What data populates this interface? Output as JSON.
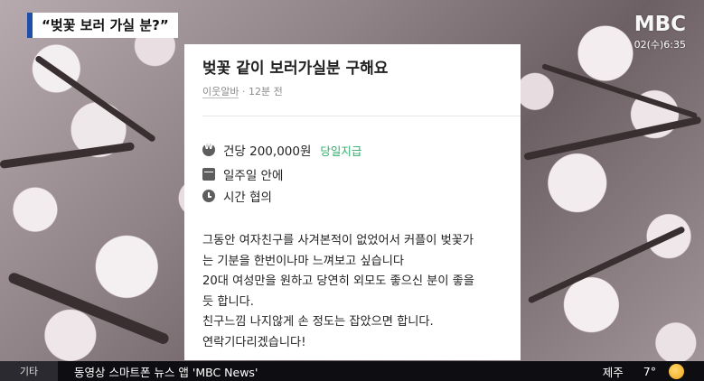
{
  "caption": "“벚꽃 보러 가실 분?”",
  "logo": {
    "name": "MBC",
    "time": "02(수)6:35"
  },
  "post": {
    "title": "벚꽃 같이 보러가실분 구해요",
    "author": "이웃알바",
    "posted": "· 12분 전",
    "pay": "건당 200,000원",
    "pay_badge": "당일지급",
    "duration": "일주일 안에",
    "hours": "시간 협의",
    "body_lines": [
      "그동안 여자친구를 사겨본적이 없었어서 커플이 벚꽃가",
      "는 기분을 한번이나마 느껴보고 싶습니다",
      "20대 여성만을 원하고 당연히 외모도 좋으신 분이 좋을",
      "듯 합니다.",
      "친구느낌 나지않게 손 정도는 잡았으면 합니다.",
      "연락기다리겠습니다!"
    ]
  },
  "ticker": {
    "category": "기타",
    "text": "동영상 스마트폰 뉴스 앱 'MBC News'"
  },
  "weather": {
    "city": "제주",
    "temp": "7°",
    "icon": "sun-icon"
  }
}
